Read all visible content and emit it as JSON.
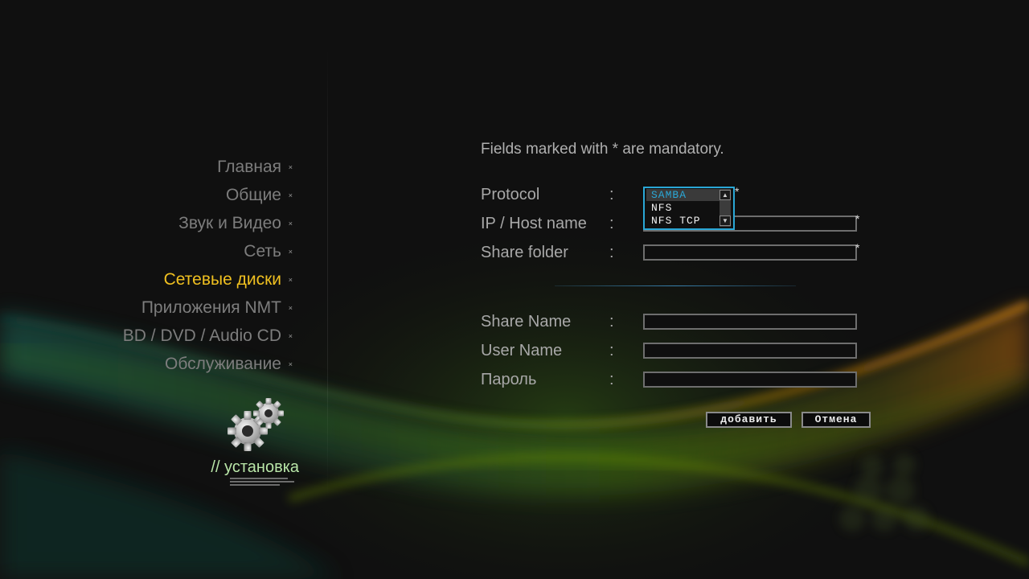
{
  "menu": {
    "items": [
      {
        "label": "Главная",
        "active": false
      },
      {
        "label": "Общие",
        "active": false
      },
      {
        "label": "Звук и Видео",
        "active": false
      },
      {
        "label": "Сеть",
        "active": false
      },
      {
        "label": "Сетевые диски",
        "active": true
      },
      {
        "label": "Приложения NMT",
        "active": false
      },
      {
        "label": "BD / DVD / Audio CD",
        "active": false
      },
      {
        "label": "Обслуживание",
        "active": false
      }
    ],
    "bullet": "×"
  },
  "section": {
    "label": "// установка",
    "icon": "gears-icon"
  },
  "form": {
    "hint": "Fields marked with * are mandatory.",
    "colon": ":",
    "required_mark": "*",
    "fields": {
      "protocol": {
        "label": "Protocol",
        "value": "SAMBA",
        "required": true
      },
      "host": {
        "label": "IP / Host name",
        "value": "",
        "required": true
      },
      "share_folder": {
        "label": "Share folder",
        "value": "",
        "required": true
      },
      "share_name": {
        "label": "Share Name",
        "value": "",
        "required": false
      },
      "user_name": {
        "label": "User Name",
        "value": "",
        "required": false
      },
      "password": {
        "label": "Пароль",
        "value": "",
        "required": false
      }
    },
    "protocol_options": [
      "SAMBA",
      "NFS",
      "NFS TCP"
    ],
    "buttons": {
      "add": "добавить",
      "cancel": "Отмена"
    }
  },
  "colors": {
    "accent_active": "#f0c020",
    "dropdown_border": "#2aa7d6",
    "setup_label": "#b9e6a8"
  }
}
